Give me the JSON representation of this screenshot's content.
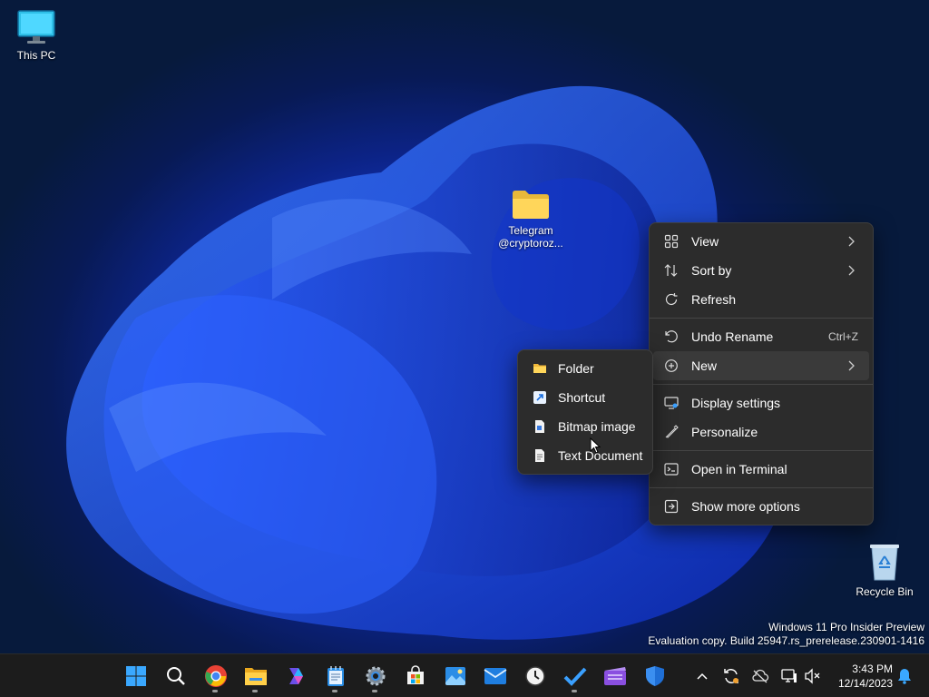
{
  "desktop": {
    "icons": {
      "this_pc": "This PC",
      "telegram_folder": "Telegram @cryptoroz...",
      "recycle_bin": "Recycle Bin"
    },
    "watermark": {
      "line1": "Windows 11 Pro Insider Preview",
      "line2": "Evaluation copy. Build 25947.rs_prerelease.230901-1416"
    }
  },
  "context_menu": {
    "items": [
      {
        "label": "View",
        "icon": "view-icon"
      },
      {
        "label": "Sort by",
        "icon": "sort-icon"
      },
      {
        "label": "Refresh",
        "icon": "refresh-icon"
      },
      {
        "label": "Undo Rename",
        "icon": "undo-icon",
        "shortcut": "Ctrl+Z"
      },
      {
        "label": "New",
        "icon": "new-icon"
      },
      {
        "label": "Display settings",
        "icon": "display-icon"
      },
      {
        "label": "Personalize",
        "icon": "pen-icon"
      },
      {
        "label": "Open in Terminal",
        "icon": "terminal-icon"
      },
      {
        "label": "Show more options",
        "icon": "more-options-icon"
      }
    ]
  },
  "new_submenu": {
    "items": [
      {
        "label": "Folder",
        "icon": "folder-icon"
      },
      {
        "label": "Shortcut",
        "icon": "shortcut-icon"
      },
      {
        "label": "Bitmap image",
        "icon": "bitmap-icon"
      },
      {
        "label": "Text Document",
        "icon": "text-document-icon"
      }
    ]
  },
  "taskbar": {
    "apps": [
      "start",
      "search",
      "chrome",
      "file-explorer",
      "copilot",
      "notepad",
      "settings",
      "store",
      "photos",
      "mail",
      "clock",
      "todo",
      "clipchamp",
      "defender"
    ],
    "clock": {
      "time": "3:43 PM",
      "date": "12/14/2023"
    }
  },
  "colors": {
    "accent": "#1e50f0",
    "menu_bg": "#2c2c2c",
    "taskbar_bg": "#1c1c1c"
  }
}
